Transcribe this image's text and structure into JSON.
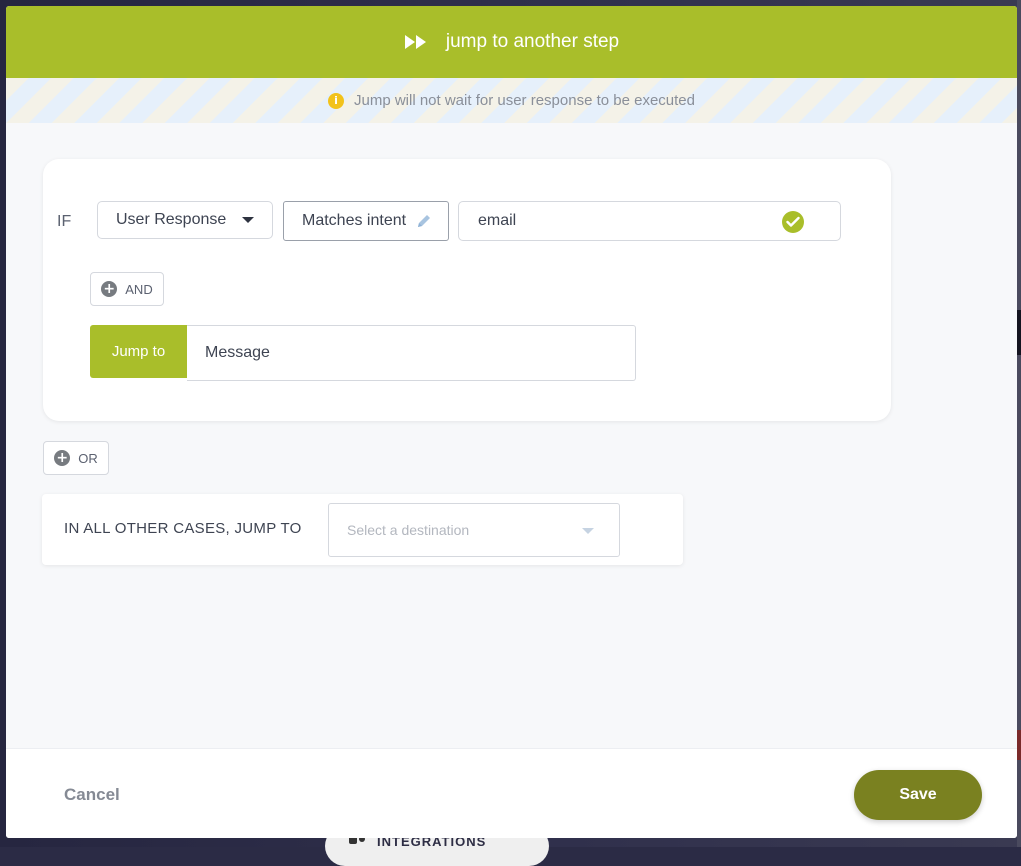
{
  "background": {
    "integrations_label": "INTEGRATIONS"
  },
  "modal": {
    "title": "jump to another step",
    "notice": "Jump will not wait for user response to be executed",
    "rule": {
      "if_label": "IF",
      "condition_field": "User Response",
      "condition_operator": "Matches intent",
      "condition_value": "email",
      "and_label": "AND",
      "jump_label": "Jump to",
      "jump_target": "Message"
    },
    "or_label": "OR",
    "other_cases": {
      "label": "IN ALL OTHER CASES, JUMP TO",
      "placeholder": "Select a destination"
    },
    "footer": {
      "cancel_label": "Cancel",
      "save_label": "Save"
    }
  },
  "colors": {
    "brand_green": "#a9be2a",
    "save_olive": "#7a8120",
    "info_yellow": "#f2c21b"
  }
}
